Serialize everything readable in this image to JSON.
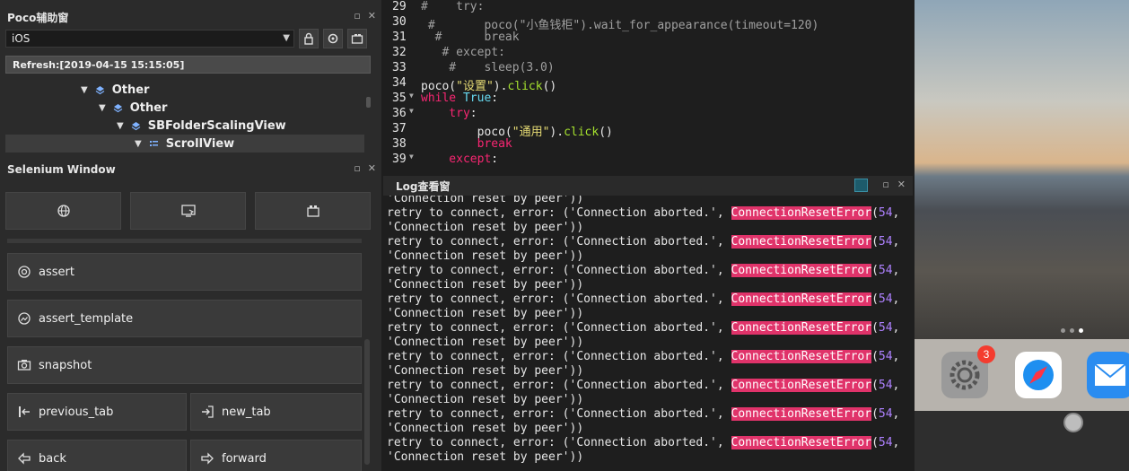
{
  "poco": {
    "title": "Poco辅助窗",
    "platform": "iOS",
    "refresh": "Refresh:[2019-04-15 15:15:05]",
    "tree": [
      {
        "label": "Other",
        "indent": 1
      },
      {
        "label": "Other",
        "indent": 2
      },
      {
        "label": "SBFolderScalingView",
        "indent": 3
      },
      {
        "label": "ScrollView",
        "indent": 4
      }
    ]
  },
  "selenium": {
    "title": "Selenium Window",
    "actions": {
      "assert": "assert",
      "assert_template": "assert_template",
      "snapshot": "snapshot",
      "previous_tab": "previous_tab",
      "new_tab": "new_tab",
      "back": "back",
      "forward": "forward"
    }
  },
  "editor": {
    "lines": [
      {
        "n": "29",
        "fold": false,
        "segs": [
          {
            "t": "#    try:",
            "c": "c-comment"
          }
        ]
      },
      {
        "n": "30",
        "fold": false,
        "segs": [
          {
            "t": " #       poco(\"小鱼钱柜\").wait_for_appearance(timeout=120)",
            "c": "c-comment"
          }
        ]
      },
      {
        "n": "31",
        "fold": false,
        "segs": [
          {
            "t": "  #      break",
            "c": "c-comment"
          }
        ]
      },
      {
        "n": "32",
        "fold": false,
        "segs": [
          {
            "t": "   # except:",
            "c": "c-comment"
          }
        ]
      },
      {
        "n": "33",
        "fold": false,
        "segs": [
          {
            "t": "    #    sleep(3.0)",
            "c": "c-comment"
          }
        ]
      },
      {
        "n": "34",
        "fold": false,
        "segs": [
          {
            "t": "poco(",
            "c": "c-plain"
          },
          {
            "t": "\"设置\"",
            "c": "c-str"
          },
          {
            "t": ").",
            "c": "c-plain"
          },
          {
            "t": "click",
            "c": "c-fn"
          },
          {
            "t": "()",
            "c": "c-plain"
          }
        ]
      },
      {
        "n": "35",
        "fold": true,
        "segs": [
          {
            "t": "while ",
            "c": "c-kw"
          },
          {
            "t": "True",
            "c": "c-bool"
          },
          {
            "t": ":",
            "c": "c-plain"
          }
        ]
      },
      {
        "n": "36",
        "fold": true,
        "segs": [
          {
            "t": "    try",
            "c": "c-kw"
          },
          {
            "t": ":",
            "c": "c-plain"
          }
        ]
      },
      {
        "n": "37",
        "fold": false,
        "segs": [
          {
            "t": "        poco(",
            "c": "c-plain"
          },
          {
            "t": "\"通用\"",
            "c": "c-str"
          },
          {
            "t": ").",
            "c": "c-plain"
          },
          {
            "t": "click",
            "c": "c-fn"
          },
          {
            "t": "()",
            "c": "c-plain"
          }
        ]
      },
      {
        "n": "38",
        "fold": false,
        "segs": [
          {
            "t": "        break",
            "c": "c-kw"
          }
        ]
      },
      {
        "n": "39",
        "fold": true,
        "segs": [
          {
            "t": "    except",
            "c": "c-kw"
          },
          {
            "t": ":",
            "c": "c-plain"
          }
        ]
      }
    ]
  },
  "log": {
    "title": "Log查看窗",
    "first_line": "'Connection reset by peer'))",
    "retry_prefix": "retry to connect, error: ('Connection aborted.', ",
    "error_name": "ConnectionResetError",
    "paren_open": "(",
    "errno": "54",
    "comma": ",",
    "second_line": "'Connection reset by peer'))",
    "repeat_count": 9
  },
  "device": {
    "settings_badge": "3"
  }
}
